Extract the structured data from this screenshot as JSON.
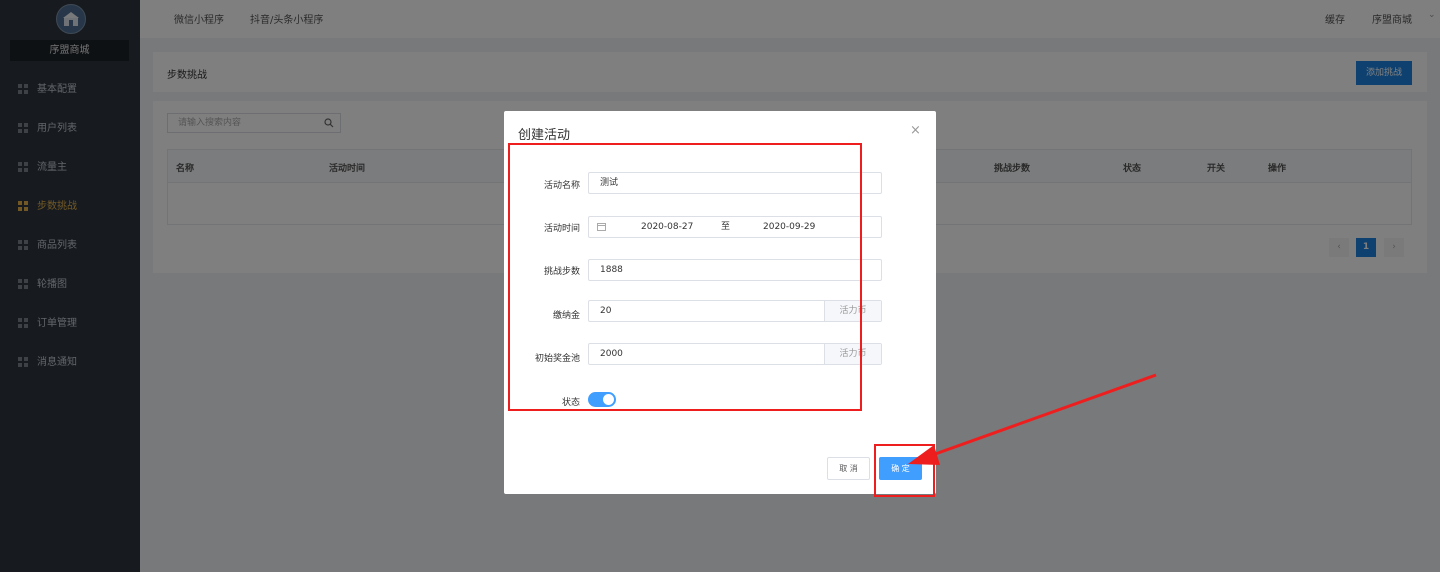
{
  "sidebar": {
    "brand": "序盟商城",
    "items": [
      {
        "label": "基本配置",
        "active": false
      },
      {
        "label": "用户列表",
        "active": false
      },
      {
        "label": "流量主",
        "active": false
      },
      {
        "label": "步数挑战",
        "active": true
      },
      {
        "label": "商品列表",
        "active": false
      },
      {
        "label": "轮播图",
        "active": false
      },
      {
        "label": "订单管理",
        "active": false
      },
      {
        "label": "消息通知",
        "active": false
      }
    ]
  },
  "topbar": {
    "tabs": [
      "微信小程序",
      "抖音/头条小程序"
    ],
    "cache": "缓存",
    "store": "序盟商城"
  },
  "page": {
    "title": "步数挑战",
    "add_button": "添加挑战",
    "search_placeholder": "请输入搜索内容",
    "columns": [
      "名称",
      "活动时间",
      "挑战步数",
      "状态",
      "开关",
      "操作"
    ],
    "current_page": "1"
  },
  "modal": {
    "title": "创建活动",
    "close": "×",
    "fields": {
      "name": {
        "label": "活动名称",
        "value": "测试"
      },
      "time": {
        "label": "活动时间",
        "start": "2020-08-27",
        "separator": "至",
        "end": "2020-09-29"
      },
      "steps": {
        "label": "挑战步数",
        "value": "1888"
      },
      "fee": {
        "label": "缴纳金",
        "value": "20",
        "addon": "活力币"
      },
      "pool": {
        "label": "初始奖金池",
        "value": "2000",
        "addon": "活力币"
      },
      "status": {
        "label": "状态",
        "on": true
      }
    },
    "cancel": "取 消",
    "ok": "确 定"
  },
  "colors": {
    "sidebar_bg": "#2f3740",
    "active_menu": "#e3b04b",
    "primary": "#409eff",
    "annotation": "#ef1e1e"
  }
}
